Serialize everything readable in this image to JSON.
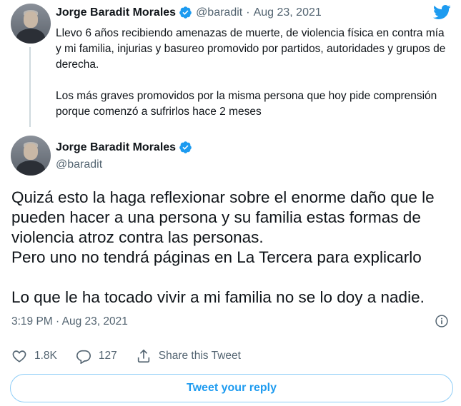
{
  "first_tweet": {
    "author_name": "Jorge Baradit Morales",
    "handle": "@baradit",
    "separator": "·",
    "date": "Aug 23, 2021",
    "paragraphs": [
      "Llevo 6 años recibiendo amenazas de muerte, de violencia física en contra mía y mi familia, injurias y basureo promovido por partidos, autoridades y grupos de derecha.",
      "Los más graves promovidos por la misma persona que hoy pide comprensión porque comenzó a sufrirlos hace 2 meses"
    ]
  },
  "main_tweet": {
    "author_name": "Jorge Baradit Morales",
    "handle": "@baradit",
    "paragraphs": [
      "Quizá esto la haga reflexionar sobre el enorme daño que le pueden hacer a una persona y su familia estas formas de violencia atroz contra las personas.\nPero uno no tendrá páginas en La Tercera para explicarlo",
      "Lo que le ha tocado vivir a mi familia no se lo doy a nadie."
    ],
    "timestamp": "3:19 PM · Aug 23, 2021"
  },
  "actions": {
    "likes": "1.8K",
    "replies": "127",
    "share_label": "Share this Tweet"
  },
  "reply_button_label": "Tweet your reply",
  "icons": {
    "verified": "verified-badge-icon",
    "brand": "twitter-bird-icon",
    "info": "info-icon",
    "like": "heart-icon",
    "reply": "reply-bubble-icon",
    "share": "share-icon"
  },
  "colors": {
    "accent": "#1d9bf0",
    "text": "#0f1419",
    "secondary": "#536471",
    "thread_line": "#cfd9de"
  }
}
